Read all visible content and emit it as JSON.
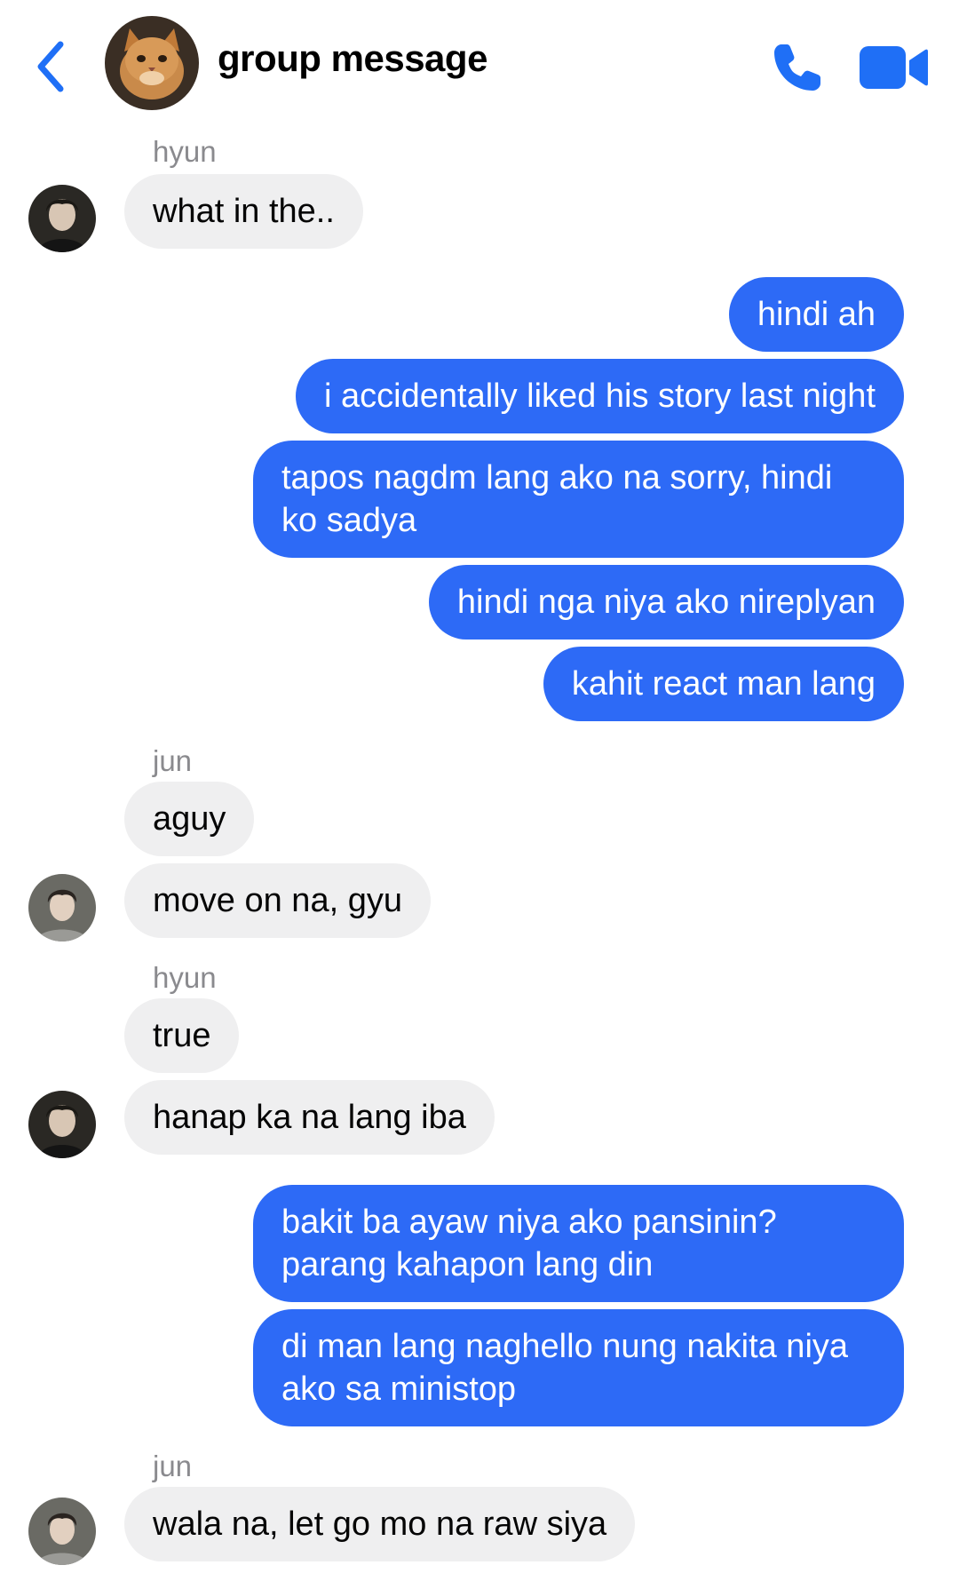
{
  "header": {
    "title": "group message",
    "back_icon": "chevron-left-icon",
    "call_icon": "phone-icon",
    "video_icon": "video-camera-icon",
    "accent": "#1f6ff6"
  },
  "colors": {
    "outgoing_bubble": "#2d6af6",
    "incoming_bubble": "#efeff0",
    "sender_label": "#8a8a8e"
  },
  "messages": {
    "g1_sender": "hyun",
    "m1": "what in the..",
    "m2": "hindi ah",
    "m3": "i accidentally liked his story last night",
    "m4": "tapos nagdm lang ako na sorry, hindi ko sadya",
    "m5": "hindi nga niya ako nireplyan",
    "m6": "kahit react man lang",
    "g2_sender": "jun",
    "m7": "aguy",
    "m8": "move on na, gyu",
    "g3_sender": "hyun",
    "m9": "true",
    "m10": "hanap ka na lang iba",
    "m11": "bakit ba ayaw niya ako pansinin? parang kahapon lang din",
    "m12": "di man lang naghello nung nakita niya ako sa ministop",
    "g4_sender": "jun",
    "m13": "wala na, let go mo na raw siya"
  }
}
